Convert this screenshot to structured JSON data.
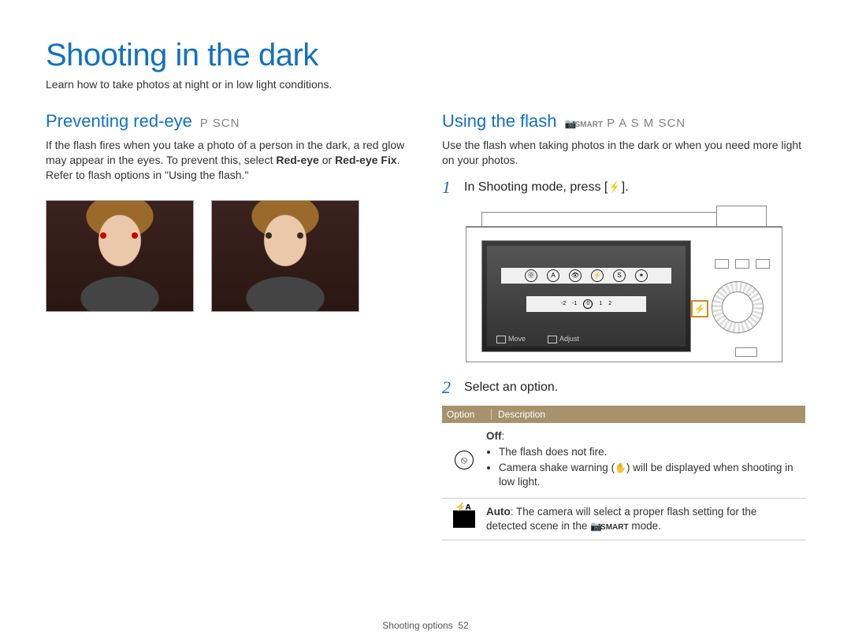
{
  "title": "Shooting in the dark",
  "subtitle": "Learn how to take photos at night or in low light conditions.",
  "footer_section": "Shooting options",
  "footer_page": "52",
  "left": {
    "heading": "Preventing red-eye",
    "modes": "P SCN",
    "body_pre": "If the flash fires when you take a photo of a person in the dark, a red glow may appear in the eyes. To prevent this, select ",
    "body_bold1": "Red-eye",
    "body_mid": " or ",
    "body_bold2": "Red-eye Fix",
    "body_post": ". Refer to flash options in \"Using the flash.\""
  },
  "right": {
    "heading": "Using the flash",
    "modes_smart": "SMART",
    "modes_rest": "P A S M SCN",
    "body": "Use the flash when taking photos in the dark or when you need more light on your photos.",
    "step1_num": "1",
    "step1_text_pre": "In Shooting mode, press [",
    "step1_text_post": "].",
    "step2_num": "2",
    "step2_text": "Select an option.",
    "screen_hint_move": "Move",
    "screen_hint_adjust": "Adjust",
    "ev_labels": {
      "n2": "-2",
      "n1": "-1",
      "z": "0",
      "p1": "1",
      "p2": "2"
    },
    "table": {
      "col1": "Option",
      "col2": "Description",
      "row_off": {
        "title": "Off",
        "b1": "The flash does not fire.",
        "b2_pre": "Camera shake warning (",
        "b2_post": ") will be displayed when shooting in low light."
      },
      "row_auto": {
        "title": "Auto",
        "text_pre": ": The camera will select a proper flash setting for the detected scene in the ",
        "text_smart": "SMART",
        "text_post": " mode."
      }
    }
  }
}
